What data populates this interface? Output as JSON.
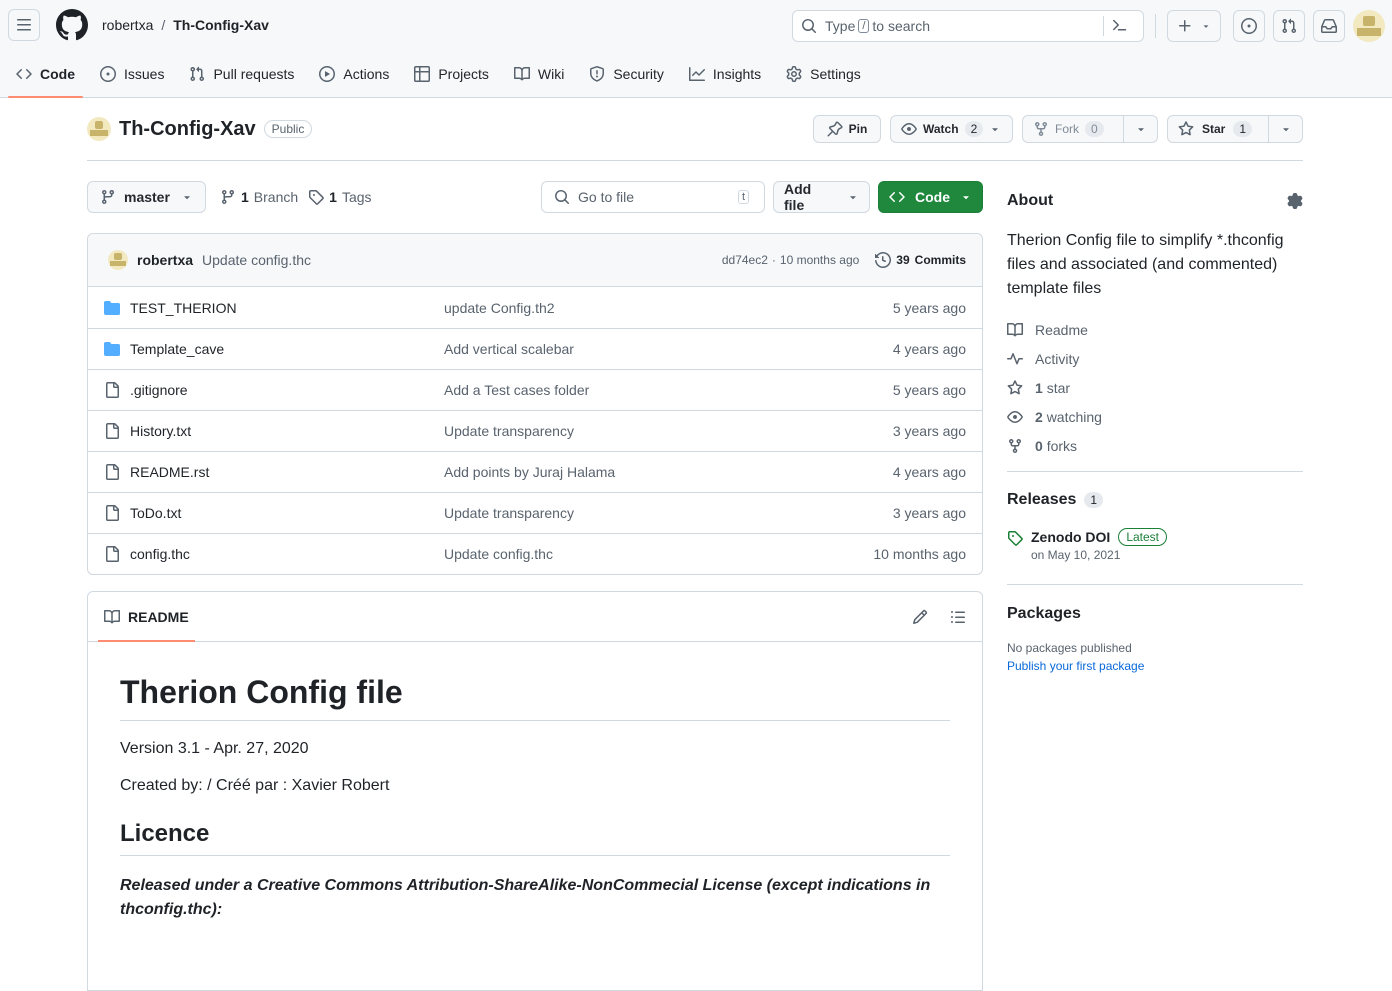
{
  "header": {
    "owner": "robertxa",
    "separator": "/",
    "repo": "Th-Config-Xav",
    "search_prefix": "Type",
    "search_key": "/",
    "search_suffix": "to search"
  },
  "tabs": [
    {
      "label": "Code",
      "icon": "code-icon"
    },
    {
      "label": "Issues",
      "icon": "issue-icon"
    },
    {
      "label": "Pull requests",
      "icon": "pull-request-icon"
    },
    {
      "label": "Actions",
      "icon": "play-icon"
    },
    {
      "label": "Projects",
      "icon": "table-icon"
    },
    {
      "label": "Wiki",
      "icon": "book-icon"
    },
    {
      "label": "Security",
      "icon": "shield-icon"
    },
    {
      "label": "Insights",
      "icon": "graph-icon"
    },
    {
      "label": "Settings",
      "icon": "gear-icon"
    }
  ],
  "repo": {
    "name": "Th-Config-Xav",
    "visibility": "Public",
    "pin_label": "Pin",
    "watch_label": "Watch",
    "watch_count": "2",
    "fork_label": "Fork",
    "fork_count": "0",
    "star_label": "Star",
    "star_count": "1"
  },
  "toolbar": {
    "branch": "master",
    "branch_count": "1",
    "branch_label": "Branch",
    "tags_count": "1",
    "tags_label": "Tags",
    "goto_placeholder": "Go to file",
    "goto_key": "t",
    "add_file": "Add file",
    "code": "Code"
  },
  "commit": {
    "author": "robertxa",
    "message": "Update config.thc",
    "hash": "dd74ec2",
    "dot": "·",
    "time": "10 months ago",
    "commits_count": "39",
    "commits_label": "Commits"
  },
  "files": [
    {
      "name": "TEST_THERION",
      "type": "dir",
      "message": "update Config.th2",
      "age": "5 years ago"
    },
    {
      "name": "Template_cave",
      "type": "dir",
      "message": "Add vertical scalebar",
      "age": "4 years ago"
    },
    {
      "name": ".gitignore",
      "type": "file",
      "message": "Add a Test cases folder",
      "age": "5 years ago"
    },
    {
      "name": "History.txt",
      "type": "file",
      "message": "Update transparency",
      "age": "3 years ago"
    },
    {
      "name": "README.rst",
      "type": "file",
      "message": "Add points by Juraj Halama",
      "age": "4 years ago"
    },
    {
      "name": "ToDo.txt",
      "type": "file",
      "message": "Update transparency",
      "age": "3 years ago"
    },
    {
      "name": "config.thc",
      "type": "file",
      "message": "Update config.thc",
      "age": "10 months ago"
    }
  ],
  "readme": {
    "tab": "README",
    "title": "Therion Config file",
    "version": "Version 3.1 - Apr. 27, 2020",
    "created": "Created by: / Créé par : Xavier Robert",
    "licence_heading": "Licence",
    "licence_text": "Released under a Creative Commons Attribution-ShareAlike-NonCommecial License (except indications in thconfig.thc):"
  },
  "about": {
    "heading": "About",
    "description": "Therion Config file to simplify *.thconfig files and associated (and commented) template files",
    "readme": "Readme",
    "activity": "Activity",
    "stars_count": "1",
    "stars_label": "star",
    "watching_count": "2",
    "watching_label": "watching",
    "forks_count": "0",
    "forks_label": "forks"
  },
  "releases": {
    "heading": "Releases",
    "count": "1",
    "name": "Zenodo DOI",
    "badge": "Latest",
    "date": "on May 10, 2021"
  },
  "packages": {
    "heading": "Packages",
    "none": "No packages published",
    "link": "Publish your first package"
  },
  "colors": {
    "accent": "#0969da",
    "green": "#1f883d",
    "tab_underline": "#fd8c73",
    "folder": "#54aeff"
  }
}
